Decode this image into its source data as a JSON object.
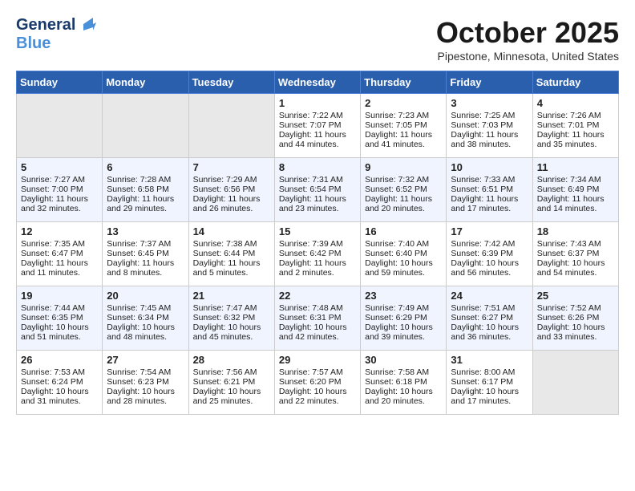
{
  "header": {
    "logo_line1": "General",
    "logo_line2": "Blue",
    "month": "October 2025",
    "location": "Pipestone, Minnesota, United States"
  },
  "days_of_week": [
    "Sunday",
    "Monday",
    "Tuesday",
    "Wednesday",
    "Thursday",
    "Friday",
    "Saturday"
  ],
  "weeks": [
    [
      {
        "day": "",
        "empty": true
      },
      {
        "day": "",
        "empty": true
      },
      {
        "day": "",
        "empty": true
      },
      {
        "day": "1",
        "sunrise": "7:22 AM",
        "sunset": "7:07 PM",
        "daylight": "11 hours and 44 minutes."
      },
      {
        "day": "2",
        "sunrise": "7:23 AM",
        "sunset": "7:05 PM",
        "daylight": "11 hours and 41 minutes."
      },
      {
        "day": "3",
        "sunrise": "7:25 AM",
        "sunset": "7:03 PM",
        "daylight": "11 hours and 38 minutes."
      },
      {
        "day": "4",
        "sunrise": "7:26 AM",
        "sunset": "7:01 PM",
        "daylight": "11 hours and 35 minutes."
      }
    ],
    [
      {
        "day": "5",
        "sunrise": "7:27 AM",
        "sunset": "7:00 PM",
        "daylight": "11 hours and 32 minutes."
      },
      {
        "day": "6",
        "sunrise": "7:28 AM",
        "sunset": "6:58 PM",
        "daylight": "11 hours and 29 minutes."
      },
      {
        "day": "7",
        "sunrise": "7:29 AM",
        "sunset": "6:56 PM",
        "daylight": "11 hours and 26 minutes."
      },
      {
        "day": "8",
        "sunrise": "7:31 AM",
        "sunset": "6:54 PM",
        "daylight": "11 hours and 23 minutes."
      },
      {
        "day": "9",
        "sunrise": "7:32 AM",
        "sunset": "6:52 PM",
        "daylight": "11 hours and 20 minutes."
      },
      {
        "day": "10",
        "sunrise": "7:33 AM",
        "sunset": "6:51 PM",
        "daylight": "11 hours and 17 minutes."
      },
      {
        "day": "11",
        "sunrise": "7:34 AM",
        "sunset": "6:49 PM",
        "daylight": "11 hours and 14 minutes."
      }
    ],
    [
      {
        "day": "12",
        "sunrise": "7:35 AM",
        "sunset": "6:47 PM",
        "daylight": "11 hours and 11 minutes."
      },
      {
        "day": "13",
        "sunrise": "7:37 AM",
        "sunset": "6:45 PM",
        "daylight": "11 hours and 8 minutes."
      },
      {
        "day": "14",
        "sunrise": "7:38 AM",
        "sunset": "6:44 PM",
        "daylight": "11 hours and 5 minutes."
      },
      {
        "day": "15",
        "sunrise": "7:39 AM",
        "sunset": "6:42 PM",
        "daylight": "11 hours and 2 minutes."
      },
      {
        "day": "16",
        "sunrise": "7:40 AM",
        "sunset": "6:40 PM",
        "daylight": "10 hours and 59 minutes."
      },
      {
        "day": "17",
        "sunrise": "7:42 AM",
        "sunset": "6:39 PM",
        "daylight": "10 hours and 56 minutes."
      },
      {
        "day": "18",
        "sunrise": "7:43 AM",
        "sunset": "6:37 PM",
        "daylight": "10 hours and 54 minutes."
      }
    ],
    [
      {
        "day": "19",
        "sunrise": "7:44 AM",
        "sunset": "6:35 PM",
        "daylight": "10 hours and 51 minutes."
      },
      {
        "day": "20",
        "sunrise": "7:45 AM",
        "sunset": "6:34 PM",
        "daylight": "10 hours and 48 minutes."
      },
      {
        "day": "21",
        "sunrise": "7:47 AM",
        "sunset": "6:32 PM",
        "daylight": "10 hours and 45 minutes."
      },
      {
        "day": "22",
        "sunrise": "7:48 AM",
        "sunset": "6:31 PM",
        "daylight": "10 hours and 42 minutes."
      },
      {
        "day": "23",
        "sunrise": "7:49 AM",
        "sunset": "6:29 PM",
        "daylight": "10 hours and 39 minutes."
      },
      {
        "day": "24",
        "sunrise": "7:51 AM",
        "sunset": "6:27 PM",
        "daylight": "10 hours and 36 minutes."
      },
      {
        "day": "25",
        "sunrise": "7:52 AM",
        "sunset": "6:26 PM",
        "daylight": "10 hours and 33 minutes."
      }
    ],
    [
      {
        "day": "26",
        "sunrise": "7:53 AM",
        "sunset": "6:24 PM",
        "daylight": "10 hours and 31 minutes."
      },
      {
        "day": "27",
        "sunrise": "7:54 AM",
        "sunset": "6:23 PM",
        "daylight": "10 hours and 28 minutes."
      },
      {
        "day": "28",
        "sunrise": "7:56 AM",
        "sunset": "6:21 PM",
        "daylight": "10 hours and 25 minutes."
      },
      {
        "day": "29",
        "sunrise": "7:57 AM",
        "sunset": "6:20 PM",
        "daylight": "10 hours and 22 minutes."
      },
      {
        "day": "30",
        "sunrise": "7:58 AM",
        "sunset": "6:18 PM",
        "daylight": "10 hours and 20 minutes."
      },
      {
        "day": "31",
        "sunrise": "8:00 AM",
        "sunset": "6:17 PM",
        "daylight": "10 hours and 17 minutes."
      },
      {
        "day": "",
        "empty": true
      }
    ]
  ]
}
